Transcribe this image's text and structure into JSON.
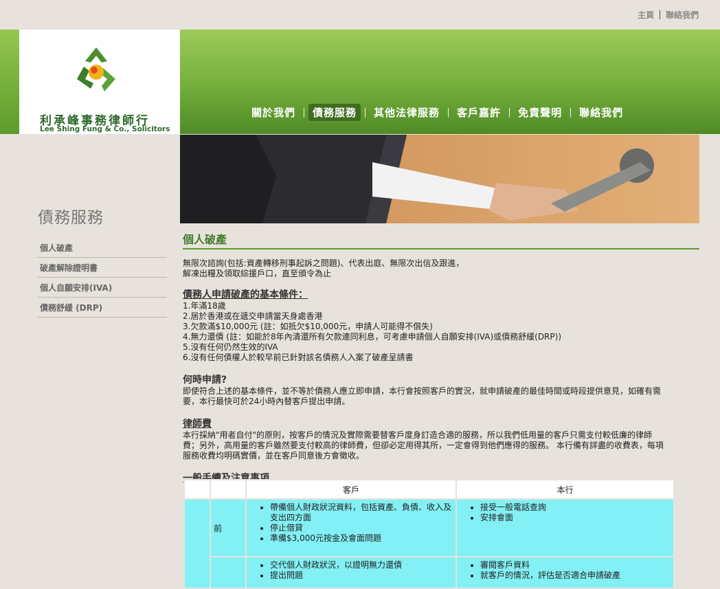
{
  "top_links": {
    "home": "主頁",
    "contact": "聯絡我們"
  },
  "logo": {
    "cn": "利承峰事務律師行",
    "en": "Lee Shing Fung & Co., Solicitors"
  },
  "nav": [
    {
      "label": "關於我們"
    },
    {
      "label": "債務服務",
      "active": true
    },
    {
      "label": "其他法律服務"
    },
    {
      "label": "客戶嘉許"
    },
    {
      "label": "免責聲明"
    },
    {
      "label": "聯絡我們"
    }
  ],
  "sidebar": {
    "title": "債務服務",
    "items": [
      {
        "label": "個人破產"
      },
      {
        "label": "破產解除證明書"
      },
      {
        "label": "個人自願安排(IVA)"
      },
      {
        "label": "債務舒緩 (DRP)"
      }
    ]
  },
  "content": {
    "title": "個人破產",
    "intro_1": "無限次諮詢(包括:資產轉移刑事起訴之問題)、代表出庭、無限次出信及跟進，",
    "intro_2": "解凍出糧及領取綜援戶口，直至頒令為止",
    "conditions_heading": "債務人申請破產的基本條件：",
    "conditions": [
      "1.年滿18歲",
      "2.居於香港或在遞交申請當天身處香港",
      "3.欠款滿$10,000元 (註：如抵欠$10,000元，申請人可能得不償失)",
      "4.無力還債 (註：如能於8年內清還所有欠款連同利息，可考慮申請個人自願安排(IVA)或債務舒緩(DRP))",
      "5.沒有任何仍然生效的IVA",
      "6.沒有任何債權人於較早前已針對該名債務人入案了破產呈請書"
    ],
    "when_heading": "何時申請?",
    "when_text": "即使符合上述的基本條件，並不等於債務人應立即申請，本行會按照客戶的實況，就申請破產的最佳時間或時段提供意見，如確有需要，本行最快可於24小時內替客戶提出申請。",
    "fee_heading": "律師費",
    "fee_text": "本行採納\"用者自付\"的原則，按客戶的情況及實際需要替客戶度身訂造合適的服務，所以我們低用量的客戶只需支付較低廉的律師費；另外，高用量的客戶雖然要支付較高的律師費，但卻必定用得其所，一定會得到他們應得的服務。 本行備有詳盡的收費表，每項服務收費均明碼實價，並在客戶同意後方會徵收。",
    "procedure_heading": "一般手續及注意事項"
  },
  "table": {
    "col_client": "客戶",
    "col_firm": "本行",
    "rows": [
      {
        "stage": "前",
        "client": [
          "帶備個人財政狀況資料，包括資產、負債、收入及支出四方面",
          "停止借貸",
          "準備$3,000元按金及會面問題"
        ],
        "firm": [
          "接受一般電話查詢",
          "安排會面"
        ]
      },
      {
        "stage": "",
        "client": [
          "交代個人財政狀況，以證明無力還債",
          "提出問題"
        ],
        "firm": [
          "審閱客戶資料",
          "就客戶的情況，評估是否適合申請破產"
        ]
      }
    ]
  },
  "colors": {
    "green": "#5c9b2c",
    "cyan": "#82f0f5",
    "bg": "#e7e3dc"
  }
}
